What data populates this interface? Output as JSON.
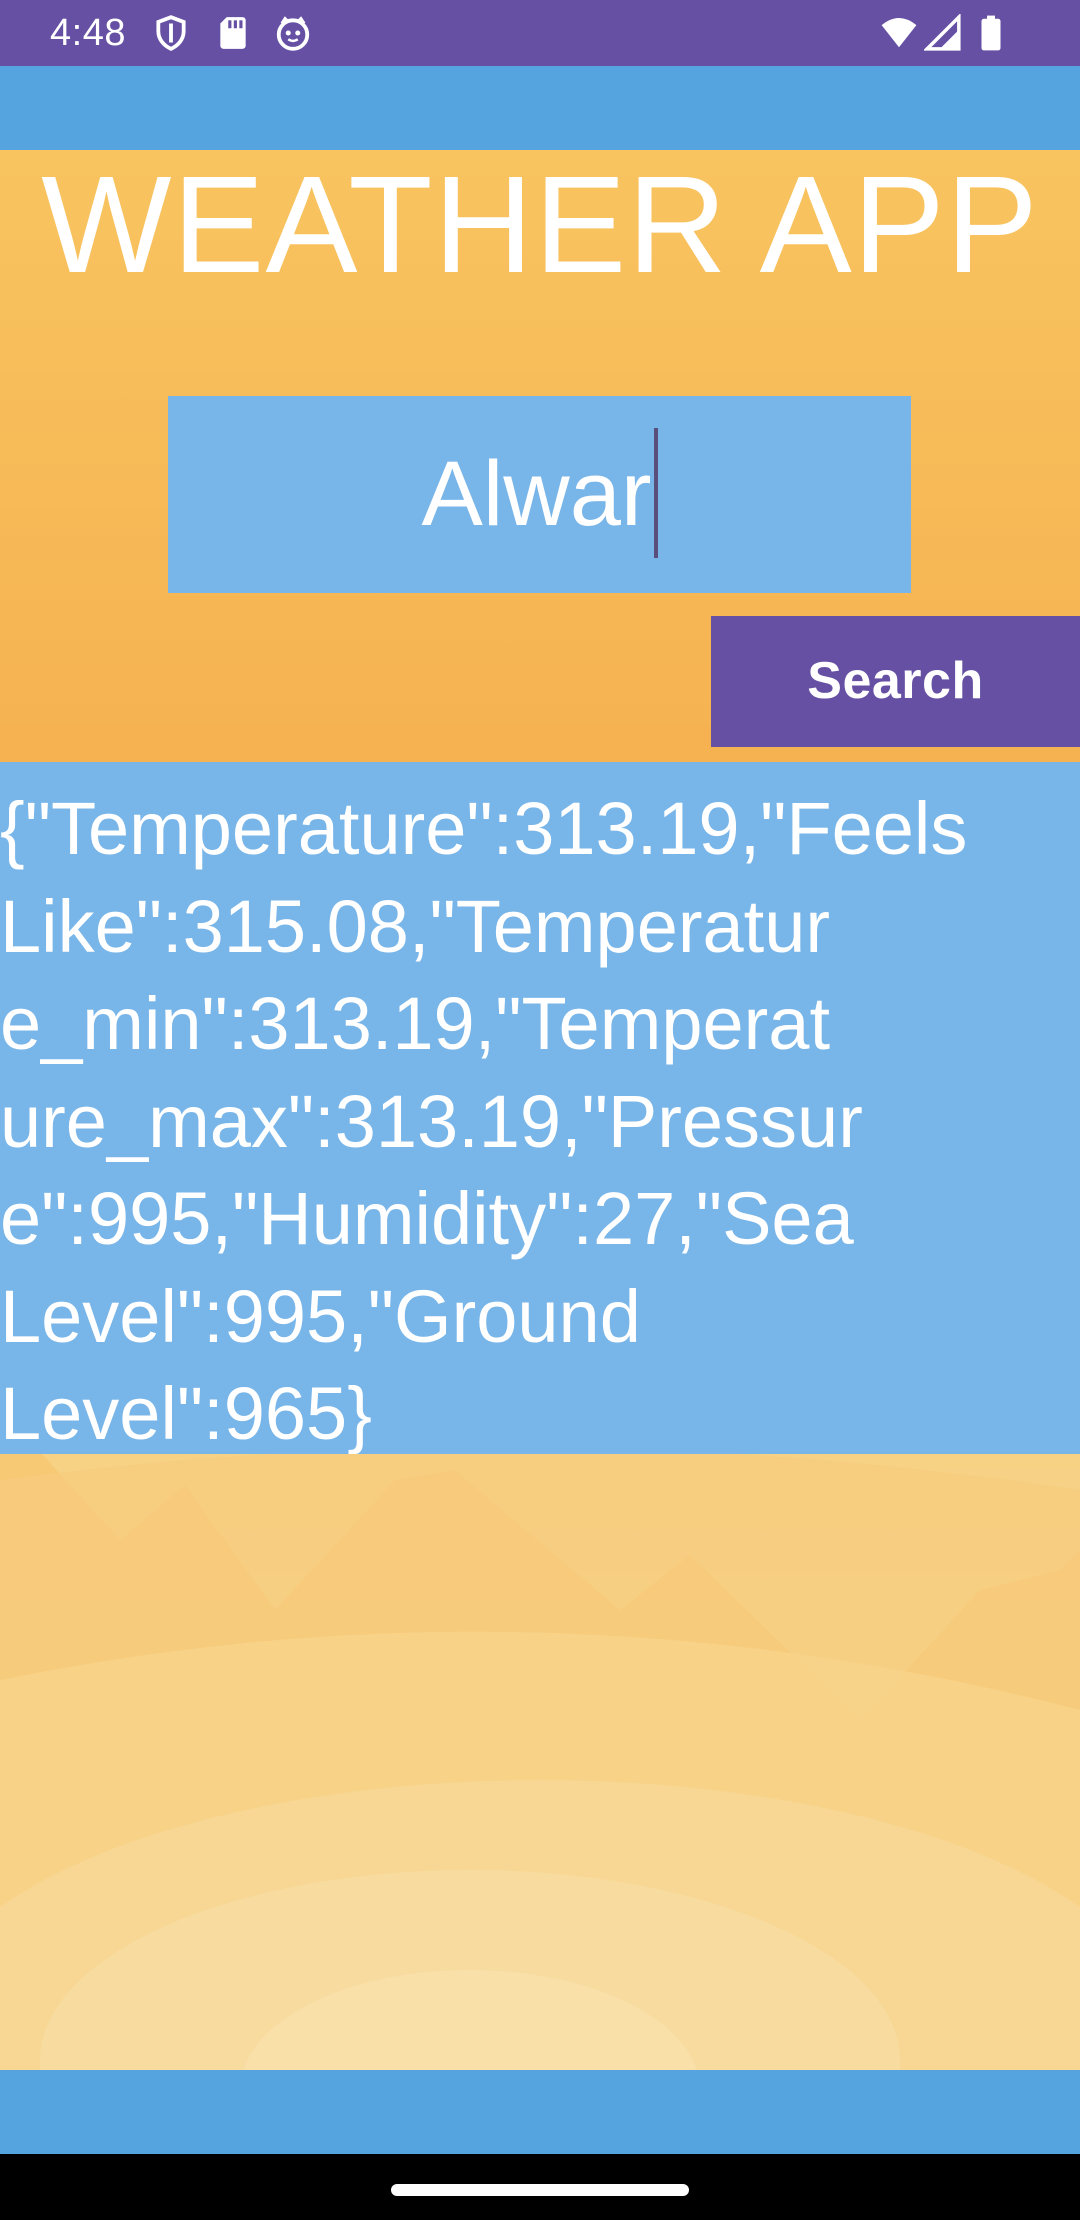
{
  "status_bar": {
    "time": "4:48",
    "icons_left": [
      "shield-icon",
      "sd-card-icon",
      "app-notification-icon"
    ],
    "icons_right": [
      "wifi-icon",
      "cell-signal-icon",
      "battery-icon"
    ],
    "background_color": "#6650a4"
  },
  "app": {
    "title": "WEATHER APP",
    "city_input": {
      "value": "Alwar"
    },
    "search_label": "Search",
    "result_lines": [
      "{\"Temperature\":313.19,\"Feels",
      "Like\":315.08,\"Temperatur",
      "e_min\":313.19,\"Temperat",
      "ure_max\":313.19,\"Pressur",
      "e\":995,\"Humidity\":27,\"Sea",
      "Level\":995,\"Ground",
      "Level\":965}"
    ]
  },
  "colors": {
    "accent_purple": "#6650a4",
    "band_blue": "#55a3df",
    "panel_blue": "#78b5e8",
    "background_orange": "#f6b452"
  }
}
